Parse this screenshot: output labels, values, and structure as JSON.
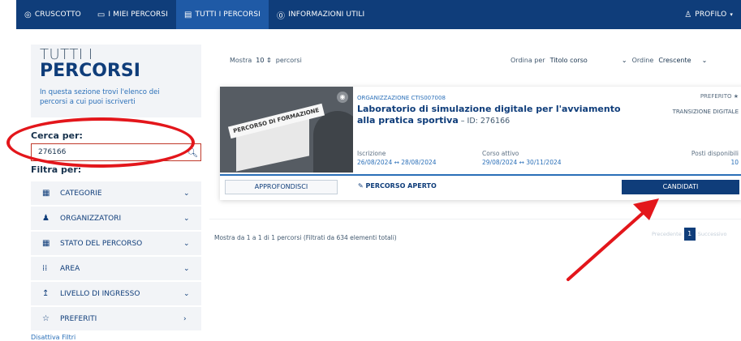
{
  "nav": {
    "items": [
      {
        "icon": "dashboard-icon",
        "glyph": "◎",
        "label": "CRUSCOTTO"
      },
      {
        "icon": "monitor-icon",
        "glyph": "▭",
        "label": "I MIEI PERCORSI"
      },
      {
        "icon": "list-icon",
        "glyph": "▤",
        "label": "TUTTI I PERCORSI"
      },
      {
        "icon": "help-icon",
        "glyph": "⓪",
        "label": "INFORMAZIONI UTILI"
      }
    ],
    "profile_label": "PROFILO"
  },
  "sidebar": {
    "title_line1": "TUTTI I",
    "title_line2": "PERCORSI",
    "description": "In questa sezione trovi l'elenco dei percorsi a cui puoi iscriverti",
    "search_label": "Cerca per:",
    "search_value": "276166",
    "filter_label": "Filtra per:",
    "filters": [
      {
        "label": "CATEGORIE",
        "icon": "grid-icon",
        "glyph": "▦",
        "chevron": "⌄"
      },
      {
        "label": "ORGANIZZATORI",
        "icon": "users-icon",
        "glyph": "♟",
        "chevron": "⌄"
      },
      {
        "label": "STATO DEL PERCORSO",
        "icon": "grid-icon",
        "glyph": "▦",
        "chevron": "⌄"
      },
      {
        "label": "AREA",
        "icon": "dots-grid-icon",
        "glyph": "⁞⁞",
        "chevron": "⌄"
      },
      {
        "label": "LIVELLO DI INGRESSO",
        "icon": "arrow-up-icon",
        "glyph": "↥",
        "chevron": "⌄"
      },
      {
        "label": "PREFERITI",
        "icon": "star-icon",
        "glyph": "☆",
        "chevron": "›"
      }
    ],
    "disable_filters": "Disattiva Filtri"
  },
  "toolbar": {
    "show_prefix": "Mostra",
    "show_value": "10",
    "show_suffix": "percorsi",
    "order_by_label": "Ordina per",
    "order_by_value": "Titolo corso",
    "order_label": "Ordine",
    "order_value": "Crescente"
  },
  "card": {
    "image_label": "PERCORSO DI FORMAZIONE",
    "organization": "ORGANIZZAZIONE CTIS007008",
    "title": "Laboratorio di simulazione digitale per l'avviamento alla pratica sportiva",
    "id_text": " – ID: 276166",
    "favorite": "PREFERITO",
    "tag": "TRANSIZIONE DIGITALE",
    "iscrizione_label": "Iscrizione",
    "iscrizione_value": "26/08/2024 ↔ 28/08/2024",
    "corso_label": "Corso attivo",
    "corso_value": "29/08/2024 ↔ 30/11/2024",
    "posti_label": "Posti disponibili",
    "posti_value": "10",
    "btn_approfondisci": "APPROFONDISCI",
    "status": "PERCORSO APERTO",
    "btn_candidati": "CANDIDATI"
  },
  "results": {
    "info": "Mostra da 1 a 1 di 1 percorsi (Filtrati da 634 elementi totali)",
    "prev": "Precedente",
    "page": "1",
    "next": "Successivo"
  },
  "colors": {
    "nav_bg": "#0f3d7a",
    "accent": "#2a6fb8",
    "annotation_red": "#e3161b"
  }
}
